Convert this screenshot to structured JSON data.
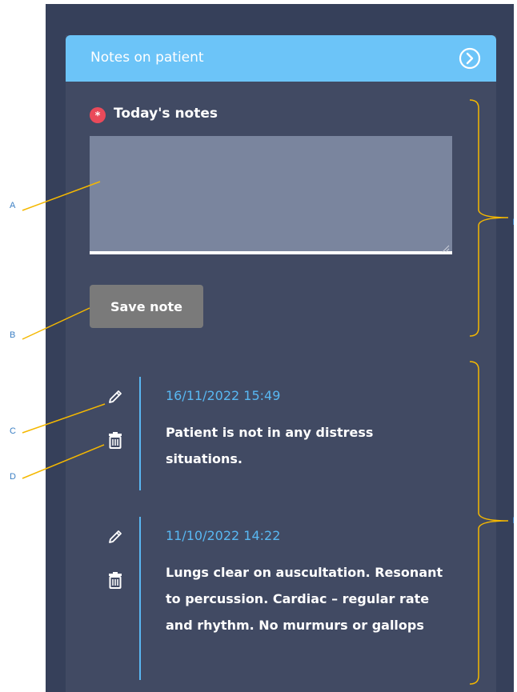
{
  "panel": {
    "title": "Notes on patient",
    "header_color": "#6cc4f8",
    "background_color": "#414a63"
  },
  "form": {
    "label": "Today's notes",
    "textarea_value": "",
    "save_label": "Save note"
  },
  "notes": [
    {
      "date": "16/11/2022 15:49",
      "text": "Patient is not in any distress situations."
    },
    {
      "date": "11/10/2022 14:22",
      "text": "Lungs clear on auscultation. Resonant to percussion. Cardiac – regular rate and rhythm. No murmurs or gallops"
    }
  ],
  "annotations": {
    "a": "A",
    "b": "B",
    "c": "C",
    "d": "D",
    "e1": "I",
    "e2": "I"
  },
  "icons": {
    "collapse": "chevron-right-circle-icon",
    "required": "asterisk-icon",
    "edit": "pencil-icon",
    "delete": "trash-icon"
  }
}
